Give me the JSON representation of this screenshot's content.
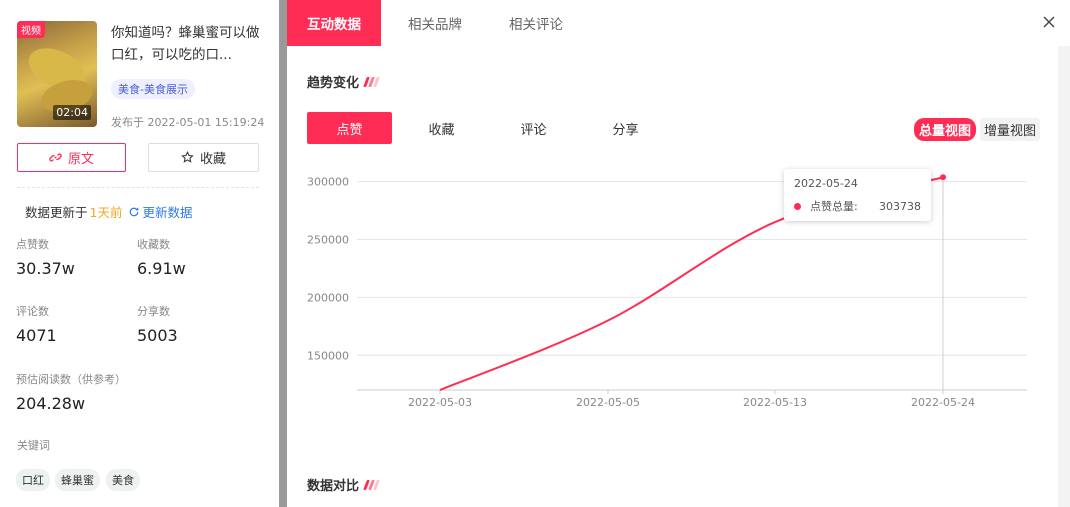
{
  "post": {
    "video_tag": "视频",
    "duration": "02:04",
    "title": "你知道吗？蜂巢蜜可以做口红，可以吃的口...",
    "category": "美食-美食展示",
    "published": "发布于 2022-05-01 15:19:24",
    "original_label": "原文",
    "favorite_label": "收藏"
  },
  "update": {
    "prefix": "数据更新于",
    "ago": "1天前",
    "refresh_label": "更新数据"
  },
  "stats": [
    {
      "label": "点赞数",
      "value": "30.37w"
    },
    {
      "label": "收藏数",
      "value": "6.91w"
    },
    {
      "label": "评论数",
      "value": "4071"
    },
    {
      "label": "分享数",
      "value": "5003"
    },
    {
      "label": "预估阅读数（供参考）",
      "value": "204.28w"
    }
  ],
  "keywords": {
    "label": "关键词",
    "items": [
      "口红",
      "蜂巢蜜",
      "美食"
    ]
  },
  "tabs": [
    "互动数据",
    "相关品牌",
    "相关评论"
  ],
  "sections": {
    "trend_title": "趋势变化",
    "compare_title": "数据对比"
  },
  "metric_tabs": [
    "点赞",
    "收藏",
    "评论",
    "分享"
  ],
  "views": {
    "total": "总量视图",
    "increment": "增量视图"
  },
  "tooltip": {
    "date": "2022-05-24",
    "series": "点赞总量:",
    "value": "303738"
  },
  "colors": {
    "accent": "#ff2d55",
    "link": "#2f7ae5",
    "warning": "#f5a623"
  },
  "chart_data": {
    "type": "line",
    "x": [
      "2022-05-03",
      "2022-05-05",
      "2022-05-13",
      "2022-05-24"
    ],
    "series": [
      {
        "name": "点赞总量",
        "values": [
          120000,
          180000,
          265000,
          303738
        ]
      }
    ],
    "yticks": [
      150000,
      200000,
      250000,
      300000
    ],
    "ylim": [
      120000,
      310000
    ],
    "grid": true
  }
}
